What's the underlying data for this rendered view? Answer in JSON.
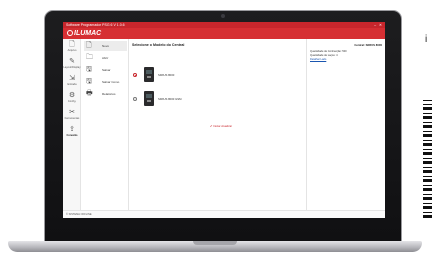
{
  "window": {
    "title": "Software Programador PSG 6 V 1.0.6",
    "controls": "–  ✕"
  },
  "brand": {
    "logo_text": "ILUMAC",
    "accent": "#c8262c"
  },
  "nav": {
    "items": [
      {
        "label": "Arquivo",
        "icon": "document-icon",
        "glyph": "🗋"
      },
      {
        "label": "Layout/Display",
        "icon": "wand-icon",
        "glyph": "✎"
      },
      {
        "label": "Entrada",
        "icon": "input-icon",
        "glyph": "⇲"
      },
      {
        "label": "Config.",
        "icon": "gear-icon",
        "glyph": "⚙"
      },
      {
        "label": "Ferramentas",
        "icon": "tools-icon",
        "glyph": "✂"
      },
      {
        "label": "Conexão",
        "icon": "usb-icon",
        "glyph": "⇪",
        "active": true
      }
    ]
  },
  "submenu": {
    "items": [
      {
        "label": "Novo",
        "glyph": "🗋",
        "active": true
      },
      {
        "label": "Abrir",
        "glyph": "🗀"
      },
      {
        "label": "Salvar",
        "glyph": "🖫"
      },
      {
        "label": "Salvar Como",
        "glyph": "🖫"
      },
      {
        "label": "Relatórios",
        "glyph": "🖶"
      }
    ]
  },
  "main": {
    "title": "Selecione o Modelo do Central",
    "models": [
      {
        "label": "SIRIUS 8000",
        "selected": true
      },
      {
        "label": "SIRIUS 8000 GSM",
        "selected": false
      }
    ],
    "more_link": "✔ Iniciar Atualizar"
  },
  "info": {
    "title": "Central: SIRIUS 8000",
    "lines": [
      "Quantidade de Conhecção: 500",
      "Quantidade de Laços: 4"
    ],
    "link": "Detalhar Lado"
  },
  "status": {
    "text": "© SISTEMA OFFLINE"
  },
  "page": {
    "side_letter": "i"
  }
}
